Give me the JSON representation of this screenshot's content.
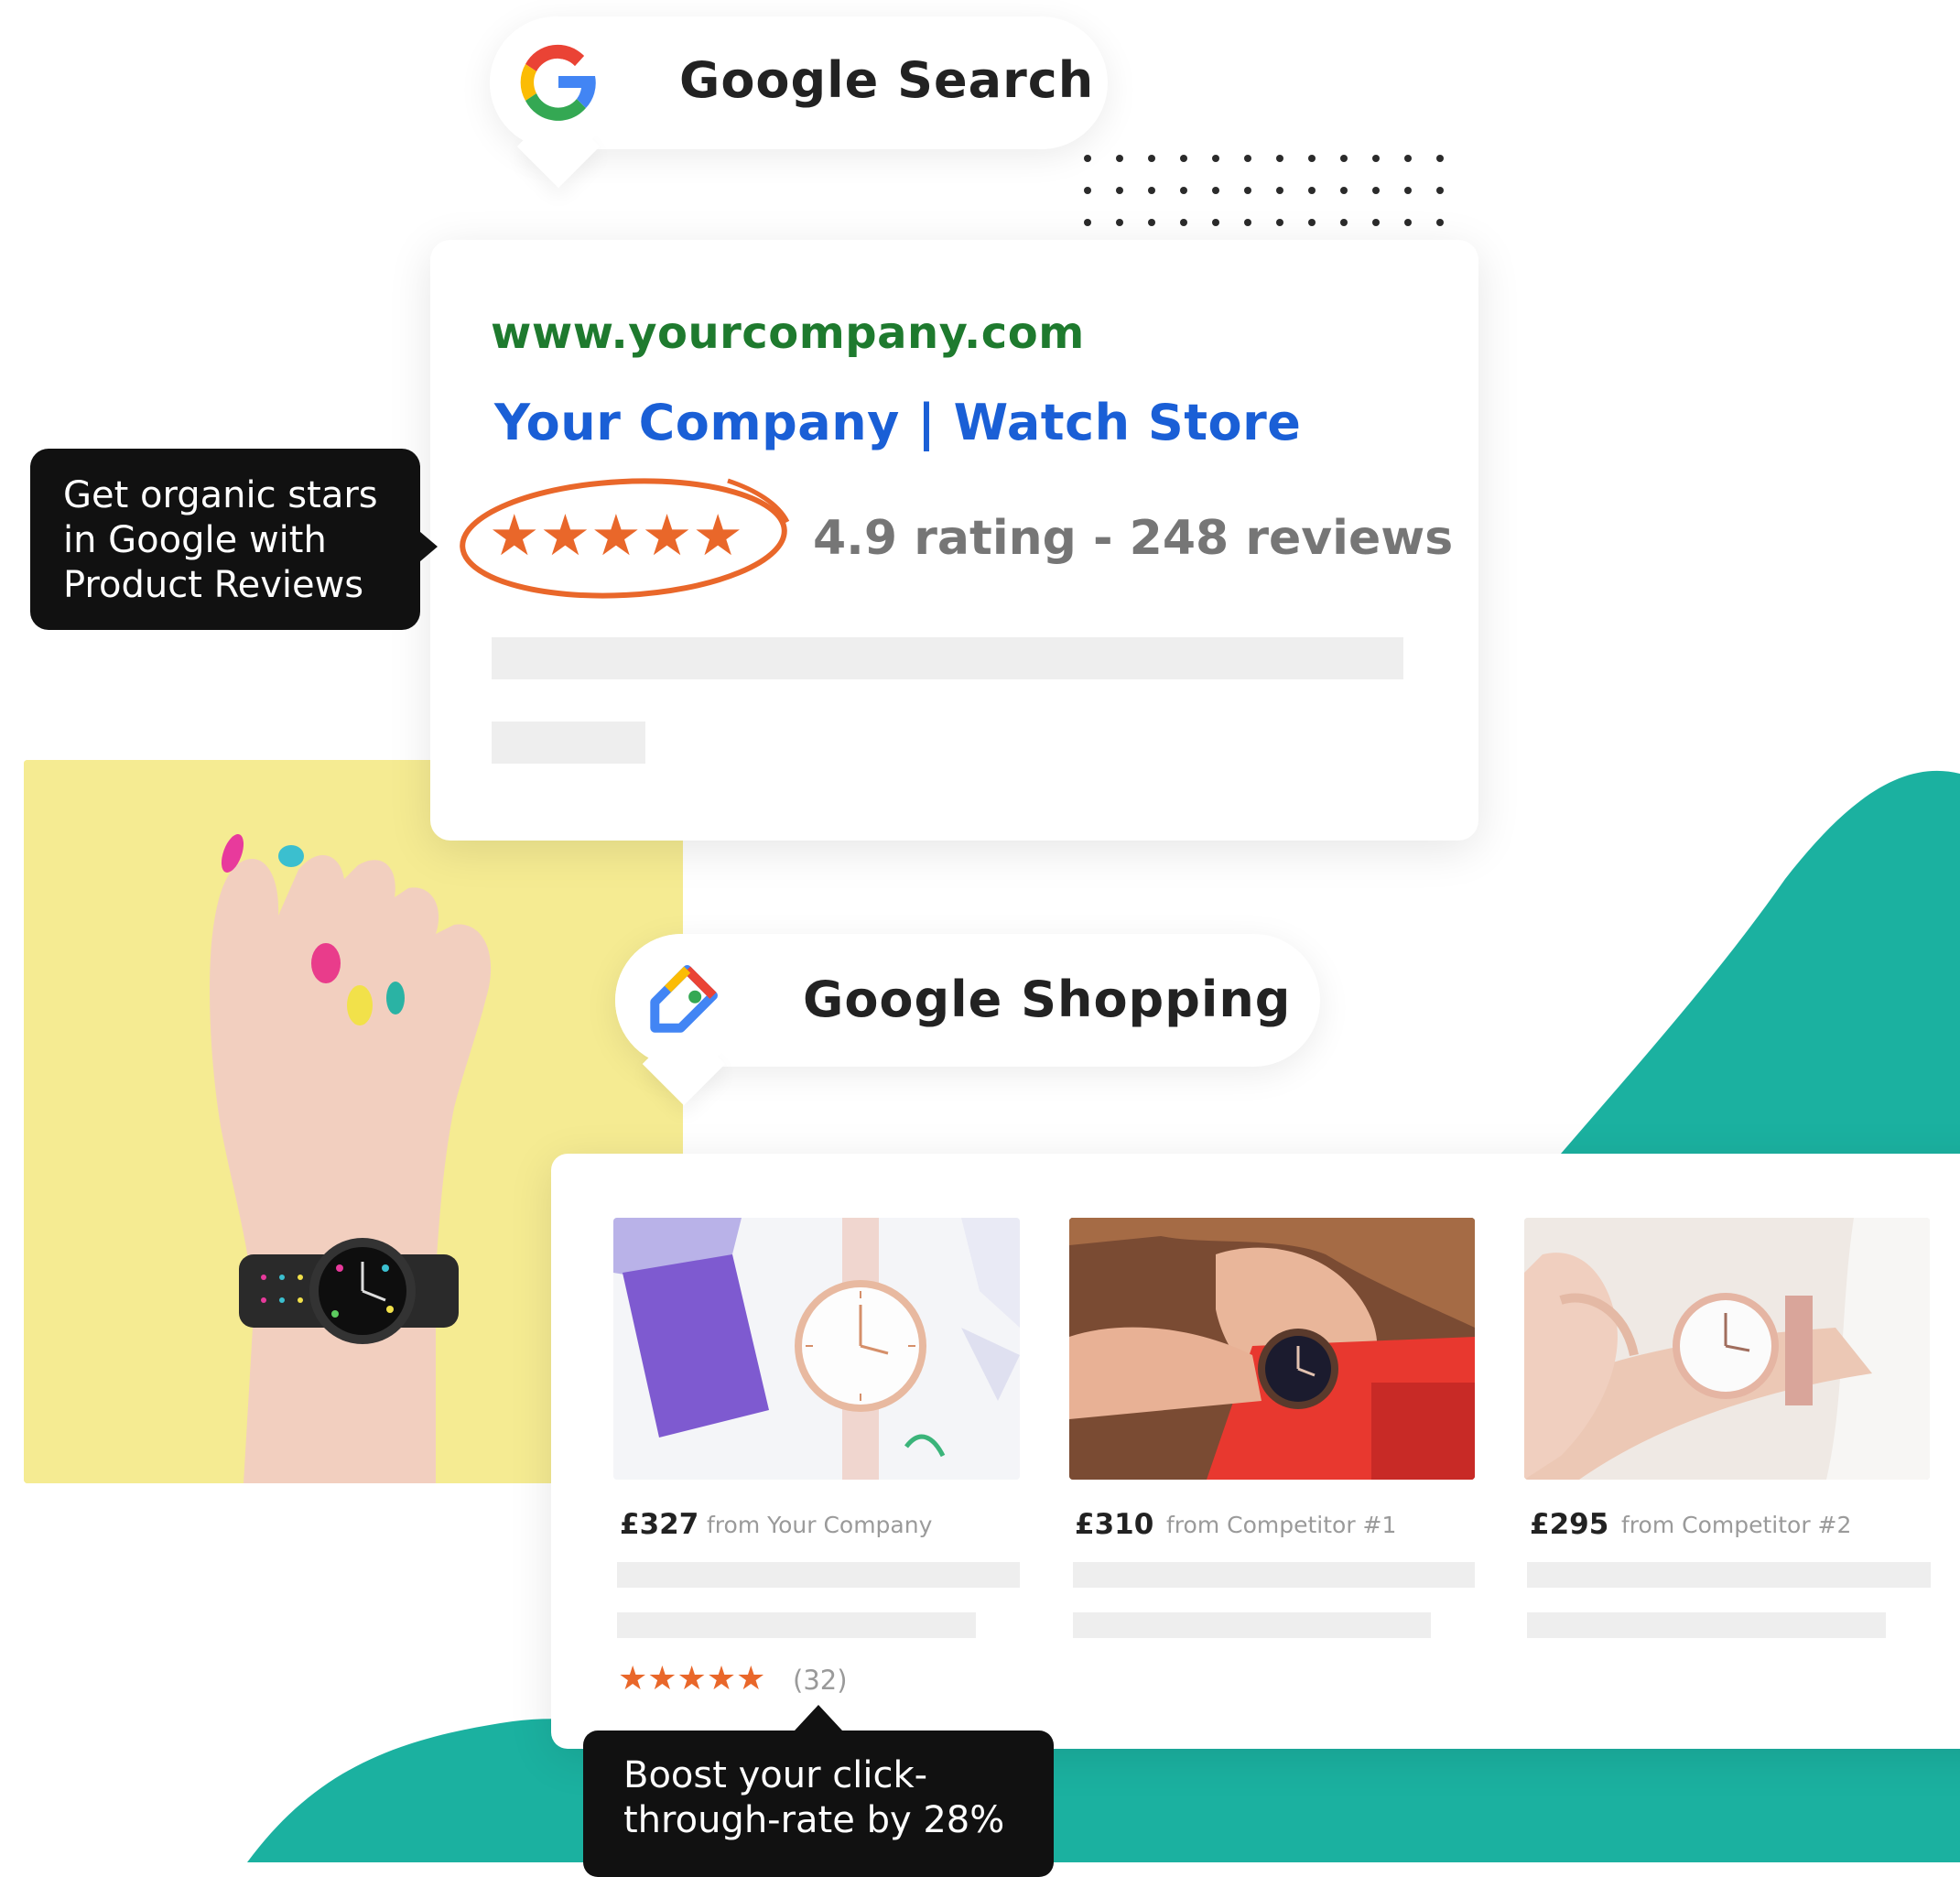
{
  "search": {
    "title": "Google Search",
    "logo_icon": "google-g-icon",
    "result": {
      "url": "www.yourcompany.com",
      "title": "Your Company | Watch Store",
      "stars": 5,
      "stars_text": "★★★★★",
      "rating_text": "4.9 rating - 248 reviews"
    }
  },
  "tooltip_search": {
    "line1": "Get organic stars",
    "line2": "in Google with",
    "line3": "Product Reviews"
  },
  "shopping": {
    "title": "Google Shopping",
    "logo_icon": "google-shopping-tag-icon",
    "products": [
      {
        "price": "£327",
        "from": "from Your Company",
        "image": "watch-on-desk-photo"
      },
      {
        "price": "£310",
        "from": "from Competitor #1",
        "image": "woman-with-watch-photo"
      },
      {
        "price": "£295",
        "from": "from Competitor #2",
        "image": "wrist-watch-photo"
      }
    ],
    "rating_stars": "★★★★★",
    "rating_count": "(32)"
  },
  "tooltip_shopping": {
    "line1": "Boost your click-",
    "line2": "through-rate by 28%"
  },
  "colors": {
    "teal": "#1bb1a0",
    "star_orange": "#e9672a",
    "url_green": "#1e7a2e",
    "link_blue": "#1a5fd6",
    "yellow_wall": "#f4ea8f"
  }
}
